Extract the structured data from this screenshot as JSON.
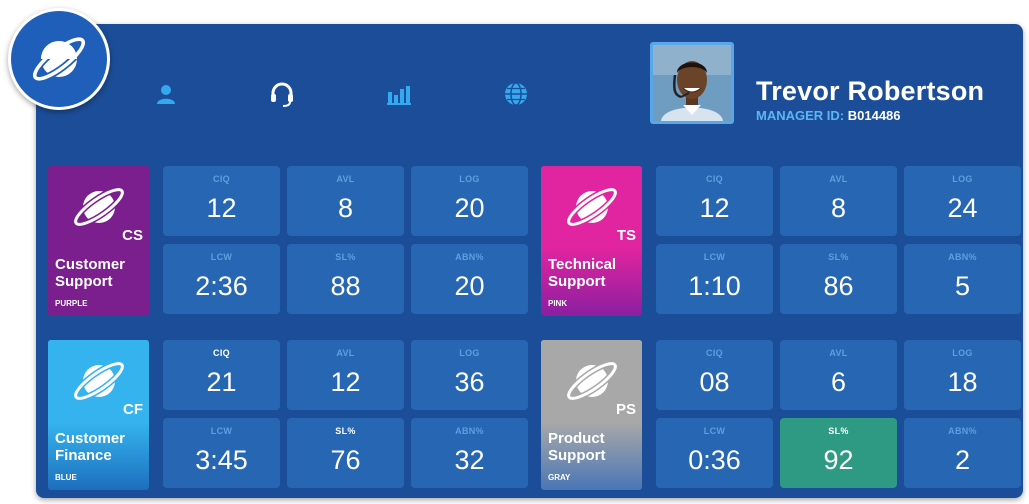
{
  "nav": {
    "icons": [
      "user-icon",
      "headset-icon",
      "bar-chart-icon",
      "globe-icon"
    ]
  },
  "user": {
    "name": "Trevor Robertson",
    "manager_label": "MANAGER ID:",
    "manager_id": "B014486"
  },
  "colors": {
    "panel": "#1c4d98",
    "tile": "#2766b3",
    "highlight": "#2e9a83",
    "purple": "#7a1f8d",
    "pink": "#e1249f",
    "blue": "#35b3ee",
    "gray": "#a8a8a8"
  },
  "teams": [
    {
      "abbr": "CS",
      "name_line1": "Customer",
      "name_line2": "Support",
      "color_label": "PURPLE",
      "metrics": [
        {
          "label": "CIQ",
          "value": "12"
        },
        {
          "label": "AVL",
          "value": "8"
        },
        {
          "label": "LOG",
          "value": "20"
        },
        {
          "label": "LCW",
          "value": "2:36"
        },
        {
          "label": "SL%",
          "value": "88"
        },
        {
          "label": "ABN%",
          "value": "20"
        }
      ]
    },
    {
      "abbr": "TS",
      "name_line1": "Technical",
      "name_line2": "Support",
      "color_label": "PINK",
      "metrics": [
        {
          "label": "CIQ",
          "value": "12"
        },
        {
          "label": "AVL",
          "value": "8"
        },
        {
          "label": "LOG",
          "value": "24"
        },
        {
          "label": "LCW",
          "value": "1:10"
        },
        {
          "label": "SL%",
          "value": "86"
        },
        {
          "label": "ABN%",
          "value": "5"
        }
      ]
    },
    {
      "abbr": "CF",
      "name_line1": "Customer",
      "name_line2": "Finance",
      "color_label": "BLUE",
      "metrics": [
        {
          "label": "CIQ",
          "value": "21"
        },
        {
          "label": "AVL",
          "value": "12"
        },
        {
          "label": "LOG",
          "value": "36"
        },
        {
          "label": "LCW",
          "value": "3:45"
        },
        {
          "label": "SL%",
          "value": "76"
        },
        {
          "label": "ABN%",
          "value": "32"
        }
      ]
    },
    {
      "abbr": "PS",
      "name_line1": "Product",
      "name_line2": "Support",
      "color_label": "GRAY",
      "metrics": [
        {
          "label": "CIQ",
          "value": "08"
        },
        {
          "label": "AVL",
          "value": "6"
        },
        {
          "label": "LOG",
          "value": "18"
        },
        {
          "label": "LCW",
          "value": "0:36"
        },
        {
          "label": "SL%",
          "value": "92"
        },
        {
          "label": "ABN%",
          "value": "2"
        }
      ]
    }
  ]
}
